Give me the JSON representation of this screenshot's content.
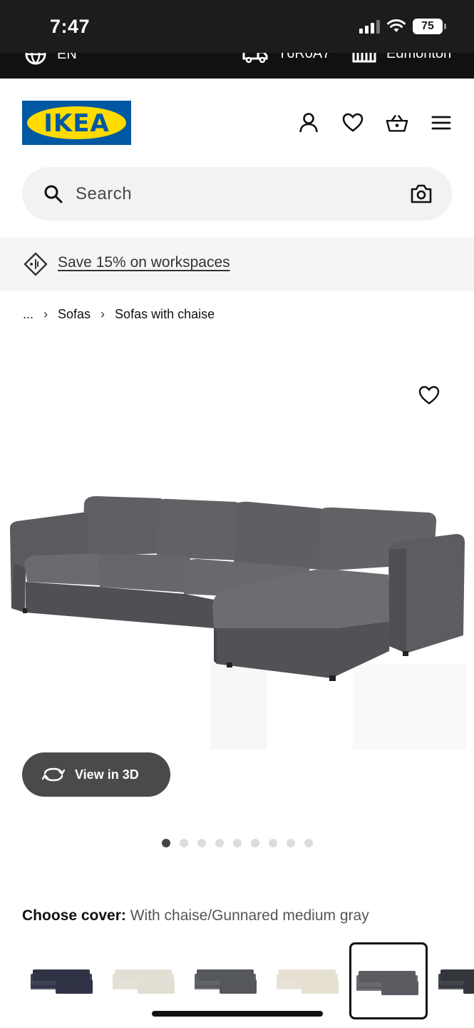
{
  "status_bar": {
    "time": "7:47",
    "battery": "75"
  },
  "utility_strip": {
    "language": "EN",
    "postal_code": "T6R0A7",
    "store": "Edmonton"
  },
  "header": {
    "logo_text": "IKEA"
  },
  "search": {
    "placeholder": "Search"
  },
  "promo": {
    "text": "Save 15% on workspaces"
  },
  "breadcrumb": {
    "ellipsis": "...",
    "items": [
      "Sofas",
      "Sofas with chaise"
    ]
  },
  "product": {
    "view_3d_label": "View in 3D",
    "carousel": {
      "total": 9,
      "active_index": 0
    },
    "choose_cover_label": "Choose cover:",
    "choose_cover_value": "With chaise/Gunnared medium gray",
    "cover_options": [
      {
        "color": "#2f3345"
      },
      {
        "color": "#e3ded4"
      },
      {
        "color": "#55575b"
      },
      {
        "color": "#e6e0d3"
      },
      {
        "color": "#5a5c61"
      },
      {
        "color": "#33363c"
      }
    ],
    "selected_cover_index": 4
  },
  "colors": {
    "ikea_blue": "#0058a3",
    "ikea_yellow": "#ffdb00",
    "sofa_gray": "#595a5e"
  }
}
